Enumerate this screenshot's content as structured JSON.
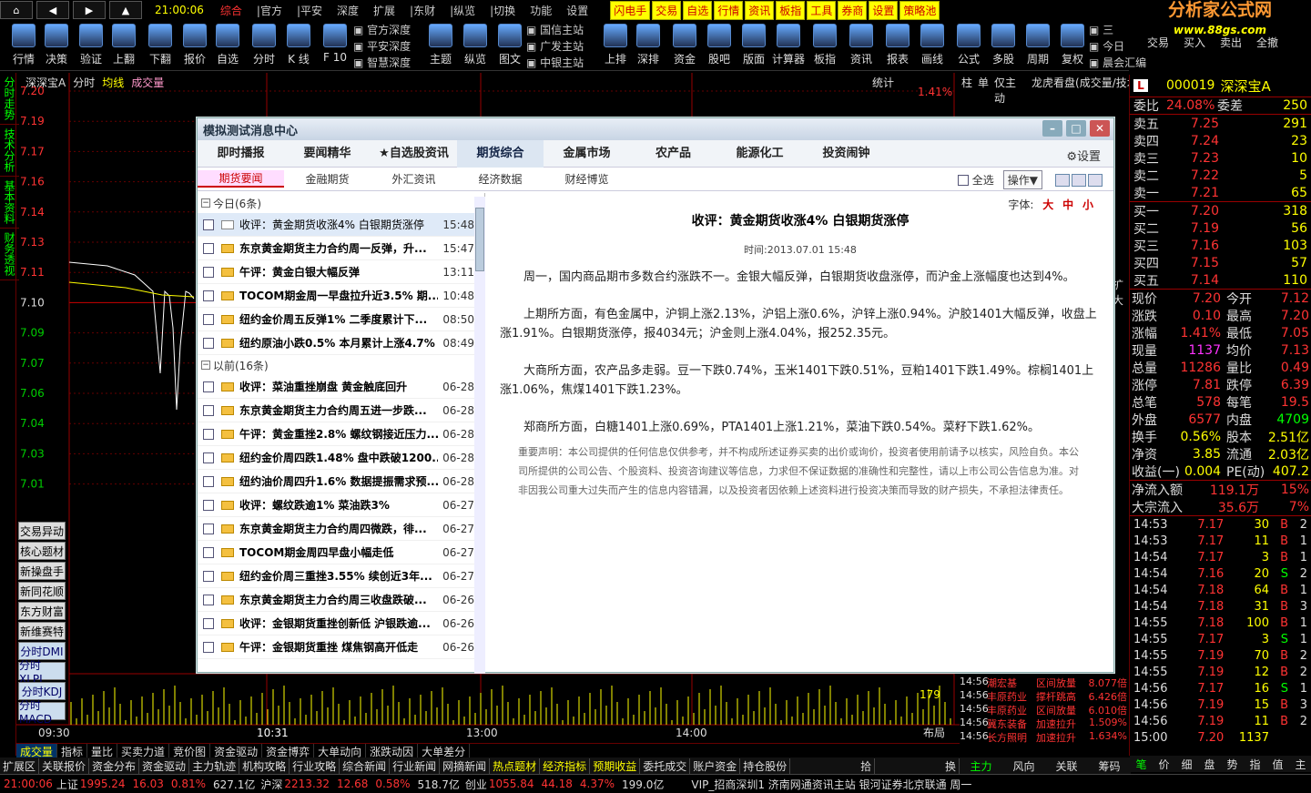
{
  "menu": {
    "clock": "21:00:06",
    "items": [
      "综合",
      "|官方",
      "|平安",
      "深度",
      "扩展",
      "|东财",
      "|纵览",
      "|切换",
      "功能",
      "设置"
    ],
    "quick": [
      "闪电手",
      "交易",
      "自选",
      "行情",
      "资讯",
      "板指",
      "工具",
      "券商",
      "设置",
      "策略池"
    ]
  },
  "logo": {
    "name": "分析家公式网",
    "url": "www.88gs.com"
  },
  "toolbar": [
    "行情",
    "决策",
    "验证",
    "上翻",
    "下翻",
    "报价",
    "自选",
    "分时",
    "K 线",
    "F 10"
  ],
  "toolbar_groups": [
    [
      "官方深度",
      "平安深度",
      "智慧深度"
    ],
    [
      "国信主站",
      "广发主站",
      "中银主站"
    ],
    [
      "三",
      "今日",
      "晨会汇编"
    ]
  ],
  "toolbar2": [
    "主题",
    "纵览",
    "图文",
    "上排",
    "深排",
    "资金",
    "股吧",
    "版面",
    "计算器",
    "板指",
    "资讯",
    "报表",
    "画线",
    "公式",
    "多股",
    "周期",
    "复权"
  ],
  "toolbar3": [
    "交易",
    "买入",
    "卖出",
    "全撤"
  ],
  "vtabs": [
    "分时走势",
    "技术分析",
    "基本资料",
    "财务透视"
  ],
  "chart": {
    "header": [
      "深深宝A",
      "分时",
      "均线",
      "成交量"
    ],
    "stat": "统计",
    "pct": "1.41%",
    "yticks": [
      "7.20",
      "7.19",
      "7.17",
      "7.16",
      "7.14",
      "7.13",
      "7.11",
      "7.10",
      "7.09",
      "7.07",
      "7.06",
      "7.04",
      "7.03",
      "7.01"
    ],
    "xticks": [
      "09:30",
      "10:31",
      "13:00",
      "14:00"
    ],
    "vol_label": "179",
    "layout_btn": "布局"
  },
  "side_buttons": [
    "交易异动",
    "核心题材",
    "新操盘手",
    "新同花顺",
    "东方财富",
    "新维赛特",
    "分时DMI",
    "分时XLPL",
    "分时KDJ",
    "分时MACD"
  ],
  "btabs1": [
    "成交量",
    "指标",
    "量比",
    "买卖力道",
    "竞价图",
    "资金驱动",
    "资金博弈",
    "大单动向",
    "涨跌动因",
    "大单差分"
  ],
  "btabs2": [
    "扩展区",
    "关联报价",
    "资金分布",
    "资金驱动",
    "主力轨迹",
    "机构攻略",
    "行业攻略",
    "综合新闻",
    "行业新闻",
    "网摘新闻",
    "热点题材",
    "经济指标",
    "预期收益",
    "委托成交",
    "账户资金",
    "持仓股份"
  ],
  "btabs2_right": [
    "拾",
    "换"
  ],
  "status": {
    "clock": "21:00:06",
    "sh": "上证",
    "sh_v": "1995.24",
    "sh_c": "16.03",
    "sh_p": "0.81%",
    "sh_a": "627.1亿",
    "sz": "沪深",
    "sz_v": "2213.32",
    "sz_c": "12.68",
    "sz_p": "0.58%",
    "sz_a": "518.7亿",
    "cy": "创业",
    "cy_v": "1055.84",
    "cy_c": "44.18",
    "cy_p": "4.37%",
    "cy_a": "199.0亿",
    "tail": "VIP_招商深圳1  济南网通资讯主站  银河证券北京联通   周一"
  },
  "mstrip": {
    "head": [
      "柱",
      "单",
      "仅主动",
      "龙虎看盘(成交量/技术)"
    ],
    "side": "扩大",
    "rows": [
      [
        "14:56",
        "潮宏基",
        "区间放量",
        "8.077倍"
      ],
      [
        "14:56",
        "丰原药业",
        "撑杆跳高",
        "6.426倍"
      ],
      [
        "14:56",
        "丰原药业",
        "区间放量",
        "6.010倍"
      ],
      [
        "14:56",
        "冀东装备",
        "加速拉升",
        "1.509%"
      ],
      [
        "14:56",
        "长方照明",
        "加速拉升",
        "1.634%"
      ]
    ],
    "tabs": [
      "主力",
      "风向",
      "关联",
      "筹码"
    ]
  },
  "quote": {
    "code": "000019",
    "name": "深深宝A",
    "wb": "委比",
    "wb_v": "24.08%",
    "wc": "委差",
    "wc_v": "250",
    "sells": [
      [
        "卖五",
        "7.25",
        "291"
      ],
      [
        "卖四",
        "7.24",
        "23"
      ],
      [
        "卖三",
        "7.23",
        "10"
      ],
      [
        "卖二",
        "7.22",
        "5"
      ],
      [
        "卖一",
        "7.21",
        "65"
      ]
    ],
    "buys": [
      [
        "买一",
        "7.20",
        "318"
      ],
      [
        "买二",
        "7.19",
        "56"
      ],
      [
        "买三",
        "7.16",
        "103"
      ],
      [
        "买四",
        "7.15",
        "57"
      ],
      [
        "买五",
        "7.14",
        "110"
      ]
    ],
    "stats": [
      [
        "现价",
        "7.20",
        "今开",
        "7.12"
      ],
      [
        "涨跌",
        "0.10",
        "最高",
        "7.20"
      ],
      [
        "涨幅",
        "1.41%",
        "最低",
        "7.05"
      ],
      [
        "现量",
        "1137",
        "均价",
        "7.13"
      ],
      [
        "总量",
        "11286",
        "量比",
        "0.49"
      ],
      [
        "涨停",
        "7.81",
        "跌停",
        "6.39"
      ],
      [
        "总笔",
        "578",
        "每笔",
        "19.5"
      ],
      [
        "外盘",
        "6577",
        "内盘",
        "4709"
      ],
      [
        "换手",
        "0.56%",
        "股本",
        "2.51亿"
      ],
      [
        "净资",
        "3.85",
        "流通",
        "2.03亿"
      ],
      [
        "收益(一)",
        "0.004",
        "PE(动)",
        "407.2"
      ]
    ],
    "flow": [
      [
        "净流入额",
        "119.1万",
        "15%"
      ],
      [
        "大宗流入",
        "35.6万",
        "7%"
      ]
    ],
    "ticks": [
      [
        "14:53",
        "7.17",
        "30",
        "B",
        "2"
      ],
      [
        "14:53",
        "7.17",
        "11",
        "B",
        "1"
      ],
      [
        "14:54",
        "7.17",
        "3",
        "B",
        "1"
      ],
      [
        "14:54",
        "7.16",
        "20",
        "S",
        "2"
      ],
      [
        "14:54",
        "7.18",
        "64",
        "B",
        "1"
      ],
      [
        "14:54",
        "7.18",
        "31",
        "B",
        "3"
      ],
      [
        "14:55",
        "7.18",
        "100",
        "B",
        "1"
      ],
      [
        "14:55",
        "7.17",
        "3",
        "S",
        "1"
      ],
      [
        "14:55",
        "7.19",
        "70",
        "B",
        "2"
      ],
      [
        "14:55",
        "7.19",
        "12",
        "B",
        "2"
      ],
      [
        "14:56",
        "7.17",
        "16",
        "S",
        "1"
      ],
      [
        "14:56",
        "7.19",
        "15",
        "B",
        "3"
      ],
      [
        "14:56",
        "7.19",
        "11",
        "B",
        "2"
      ],
      [
        "15:00",
        "7.20",
        "1137",
        "",
        ""
      ]
    ],
    "bottom_tabs": [
      "笔",
      "价",
      "细",
      "盘",
      "势",
      "指",
      "值",
      "主"
    ]
  },
  "dialog": {
    "title": "模拟测试消息中心",
    "tabs": [
      "即时播报",
      "要闻精华",
      "★自选股资讯",
      "期货综合",
      "金属市场",
      "农产品",
      "能源化工",
      "投资闹钟"
    ],
    "active_tab": "期货综合",
    "settings": "设置",
    "subtabs": [
      "期货要闻",
      "金融期货",
      "外汇资讯",
      "经济数据",
      "财经博览"
    ],
    "select_all": "全选",
    "op": "操作▼",
    "today": "今日(6条)",
    "before": "以前(16条)",
    "news_today": [
      [
        "收评：黄金期货收涨4% 白银期货涨停",
        "15:48"
      ],
      [
        "东京黄金期货主力合约周一反弹，升...",
        "15:47"
      ],
      [
        "午评：黄金白银大幅反弹",
        "13:11"
      ],
      [
        "TOCOM期金周一早盘拉升近3.5% 期...",
        "10:48"
      ],
      [
        "纽约金价周五反弹1% 二季度累计下...",
        "08:50"
      ],
      [
        "纽约原油小跌0.5% 本月累计上涨4.7%",
        "08:49"
      ]
    ],
    "news_before": [
      [
        "收评：菜油重挫崩盘 黄金触底回升",
        "06-28"
      ],
      [
        "东京黄金期货主力合约周五进一步跌...",
        "06-28"
      ],
      [
        "午评：黄金重挫2.8% 螺纹钢接近压力...",
        "06-28"
      ],
      [
        "纽约金价周四跌1.48% 盘中跌破1200...",
        "06-28"
      ],
      [
        "纽约油价周四升1.6% 数据提振需求预...",
        "06-28"
      ],
      [
        "收评：螺纹跌逾1% 菜油跌3%",
        "06-27"
      ],
      [
        "东京黄金期货主力合约周四微跌，徘...",
        "06-27"
      ],
      [
        "TOCOM期金周四早盘小幅走低",
        "06-27"
      ],
      [
        "纽约金价周三重挫3.55% 续创近3年...",
        "06-27"
      ],
      [
        "东京黄金期货主力合约周三收盘跌破...",
        "06-26"
      ],
      [
        "收评：金银期货重挫创新低 沪银跌逾...",
        "06-26"
      ],
      [
        "午评：金银期货重挫 煤焦钢高开低走",
        "06-26"
      ]
    ],
    "font_label": "字体:",
    "font_sizes": [
      "大",
      "中",
      "小"
    ],
    "article": {
      "title": "收评：黄金期货收涨4% 白银期货涨停",
      "time": "时间:2013.07.01 15:48",
      "paras": [
        "周一，国内商品期市多数合约涨跌不一。金银大幅反弹，白银期货收盘涨停，而沪金上涨幅度也达到4%。",
        "上期所方面，有色金属中，沪铜上涨2.13%，沪铝上涨0.6%，沪锌上涨0.94%。沪胶1401大幅反弹，收盘上涨1.91%。白银期货涨停，报4034元；沪金则上涨4.04%，报252.35元。",
        "大商所方面，农产品多走弱。豆一下跌0.74%，玉米1401下跌0.51%，豆粕1401下跌1.49%。棕榈1401上涨1.06%，焦煤1401下跌1.23%。",
        "郑商所方面，白糖1401上涨0.69%，PTA1401上涨1.21%，菜油下跌0.54%。菜籽下跌1.62%。"
      ],
      "disclaimer": "重要声明：本公司提供的任何信息仅供参考，并不构成所述证券买卖的出价或询价，投资者使用前请予以核实，风险自负。本公司所提供的公司公告、个股资料、投资咨询建议等信息，力求但不保证数据的准确性和完整性，请以上市公司公告信息为准。对非因我公司重大过失而产生的信息内容错漏，以及投资者因依赖上述资料进行投资决策而导致的财产损失，不承担法律责任。"
    }
  }
}
